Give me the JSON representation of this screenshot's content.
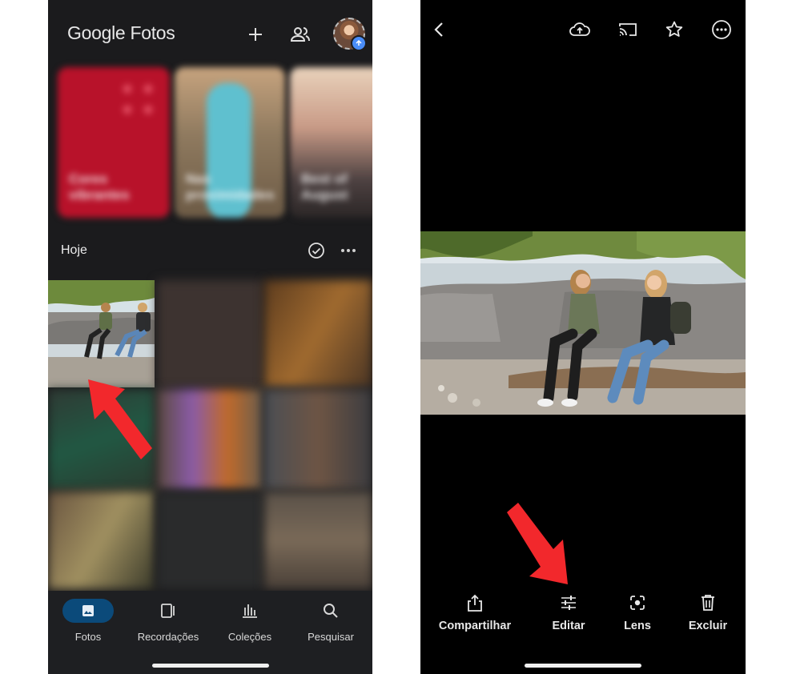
{
  "left": {
    "app_title": "Google Fotos",
    "header_icons": [
      "plus-icon",
      "shared-people-icon",
      "avatar"
    ],
    "memories": [
      {
        "label": "Cores vibrantes",
        "color": "#c0122a"
      },
      {
        "label": "Nas proximidades",
        "color": "#7a6a50"
      },
      {
        "label": "Best of August",
        "color": "#6b5b52"
      }
    ],
    "section_title": "Hoje",
    "bottom_nav": [
      {
        "label": "Fotos",
        "icon": "photo-icon",
        "active": true
      },
      {
        "label": "Recordações",
        "icon": "memories-icon",
        "active": false
      },
      {
        "label": "Coleções",
        "icon": "collections-icon",
        "active": false
      },
      {
        "label": "Pesquisar",
        "icon": "search-icon",
        "active": false
      }
    ],
    "accent": "#0b4a7a"
  },
  "right": {
    "top_icons": [
      "back-icon",
      "cloud-upload-icon",
      "cast-icon",
      "star-icon",
      "more-icon"
    ],
    "actions": [
      {
        "label": "Compartilhar",
        "icon": "share-icon"
      },
      {
        "label": "Editar",
        "icon": "edit-sliders-icon"
      },
      {
        "label": "Lens",
        "icon": "lens-icon"
      },
      {
        "label": "Excluir",
        "icon": "trash-icon"
      }
    ]
  },
  "annotation_color": "#f2282c"
}
